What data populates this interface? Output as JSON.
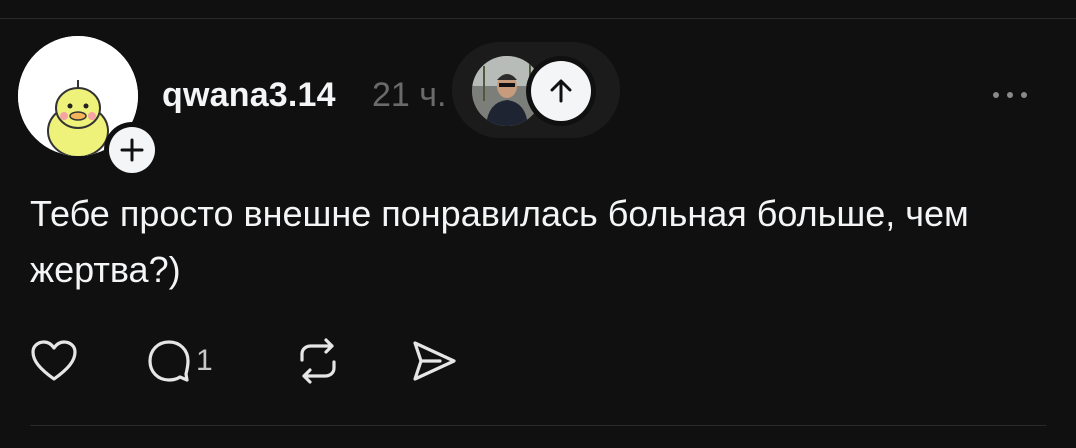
{
  "post": {
    "username": "qwana3.14",
    "timestamp": "21 ч.",
    "text": "Тебе просто внешне понравилась больная больше, чем жертва?)",
    "reply_count": "1"
  },
  "icons": {
    "follow": "plus-icon",
    "scroll_up": "arrow-up-icon",
    "more": "more-horizontal-icon",
    "like": "heart-icon",
    "reply": "comment-icon",
    "repost": "repost-icon",
    "share": "send-icon"
  },
  "colors": {
    "background": "#101010",
    "text": "#f3f5f7",
    "muted": "#6a6a6a",
    "divider": "#2a2a2a"
  }
}
